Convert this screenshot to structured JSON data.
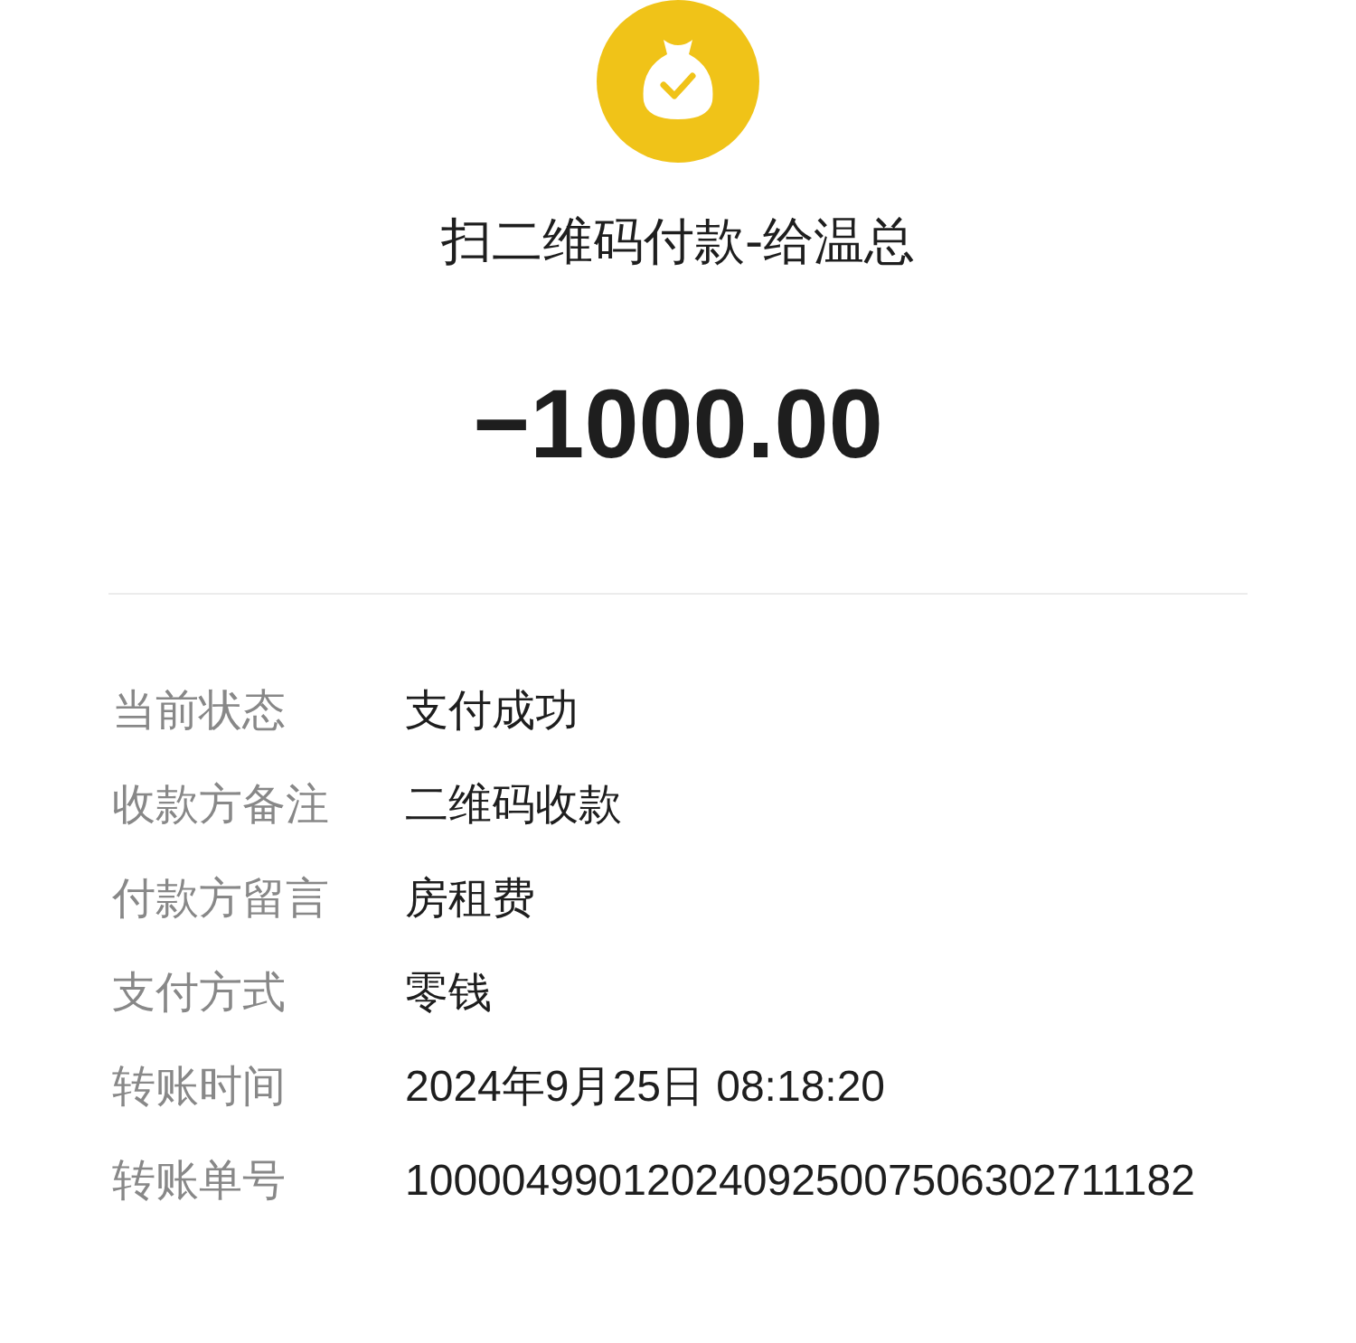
{
  "title": "扫二维码付款-给温总",
  "amount": "−1000.00",
  "details": [
    {
      "label": "当前状态",
      "value": "支付成功"
    },
    {
      "label": "收款方备注",
      "value": "二维码收款"
    },
    {
      "label": "付款方留言",
      "value": "房租费"
    },
    {
      "label": "支付方式",
      "value": "零钱"
    },
    {
      "label": "转账时间",
      "value": "2024年9月25日 08:18:20"
    },
    {
      "label": "转账单号",
      "value": "100004990120240925007506302711182"
    }
  ]
}
